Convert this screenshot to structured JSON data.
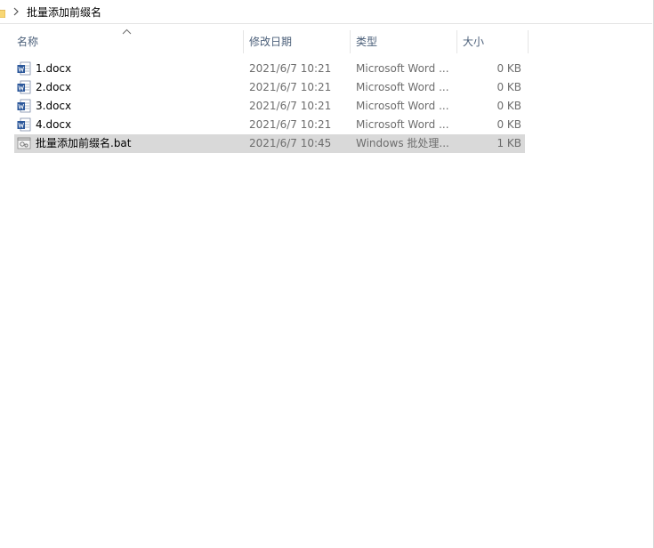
{
  "addressbar": {
    "path": "批量添加前缀名"
  },
  "columns": {
    "name": "名称",
    "date": "修改日期",
    "type": "类型",
    "size": "大小"
  },
  "files": [
    {
      "name": "1.docx",
      "date": "2021/6/7 10:21",
      "type": "Microsoft Word ...",
      "size": "0 KB",
      "icon": "word-doc-icon"
    },
    {
      "name": "2.docx",
      "date": "2021/6/7 10:21",
      "type": "Microsoft Word ...",
      "size": "0 KB",
      "icon": "word-doc-icon"
    },
    {
      "name": "3.docx",
      "date": "2021/6/7 10:21",
      "type": "Microsoft Word ...",
      "size": "0 KB",
      "icon": "word-doc-icon"
    },
    {
      "name": "4.docx",
      "date": "2021/6/7 10:21",
      "type": "Microsoft Word ...",
      "size": "0 KB",
      "icon": "word-doc-icon"
    },
    {
      "name": "批量添加前缀名.bat",
      "date": "2021/6/7 10:45",
      "type": "Windows 批处理...",
      "size": "1 KB",
      "icon": "batch-file-icon",
      "selected": true
    }
  ],
  "colors": {
    "selection": "#d9d9d9",
    "header_text": "#4c607a",
    "detail_text": "#6d6d6d",
    "word_blue": "#2b579a"
  }
}
